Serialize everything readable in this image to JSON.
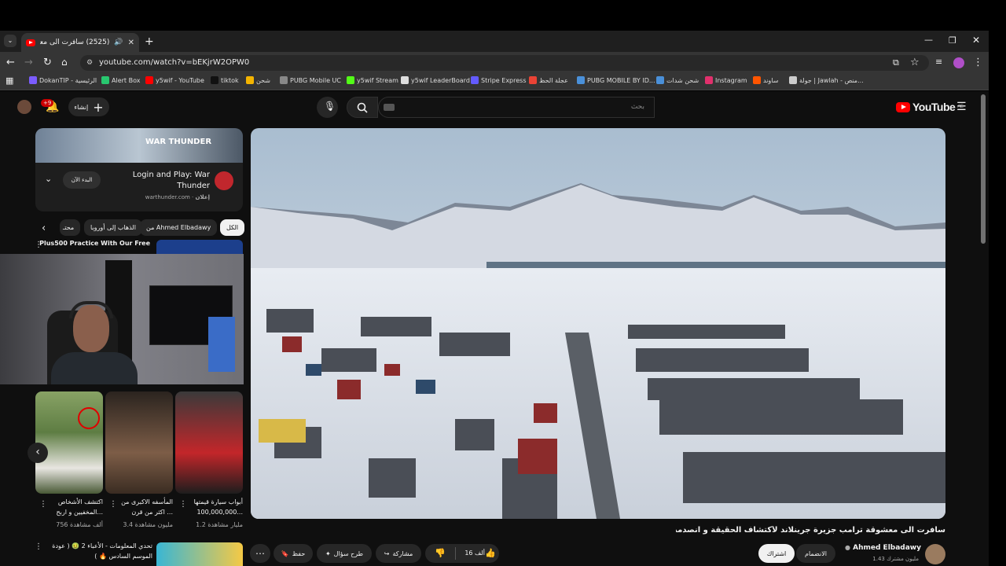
{
  "browser": {
    "tab_title": "(2525) سافرت الى معشوقة :",
    "url": "youtube.com/watch?v=bEKjrW2OPW0",
    "bookmarks": [
      {
        "label": "DokanTIP - الرئيسية",
        "color": "#7b5cff"
      },
      {
        "label": "Alert Box",
        "color": "#28c76f"
      },
      {
        "label": "y5wif - YouTube",
        "color": "#ff0000"
      },
      {
        "label": "tiktok",
        "color": "#111111"
      },
      {
        "label": "شحن",
        "color": "#f4b400"
      },
      {
        "label": "PUBG Mobile UC",
        "color": "#888888"
      },
      {
        "label": "y5wif Stream",
        "color": "#53fc18"
      },
      {
        "label": "y5wif LeaderBoard",
        "color": "#dddddd"
      },
      {
        "label": "Stripe Express",
        "color": "#635bff"
      },
      {
        "label": "عجلة الحظ",
        "color": "#ea4335"
      },
      {
        "label": "PUBG MOBILE BY ID...",
        "color": "#4a90d9"
      },
      {
        "label": "شحن شدات",
        "color": "#4a90d9"
      },
      {
        "label": "Instagram",
        "color": "#e1306c"
      },
      {
        "label": "ساوند",
        "color": "#ff5500"
      },
      {
        "label": "جولة | Jawlah - منص...",
        "color": "#cccccc"
      }
    ]
  },
  "youtube": {
    "search_placeholder": "بحث",
    "create_label": "إنشاء",
    "notifications_badge": "+9",
    "logo_text": "YouTube",
    "logo_country": "AE"
  },
  "ad": {
    "title": "Login and Play: War Thunder",
    "sponsor_label": "إعلان",
    "domain": "warthunder.com",
    "cta": "البدء الآن"
  },
  "chips": [
    "الكل",
    "من Ahmed Elbadawy",
    "الذهاب إلى أوروبا",
    "محتـ"
  ],
  "plus500": {
    "title": "Plus500 Practice With Our Free"
  },
  "shorts": [
    {
      "title": "اكتشف الأشخاص المخفيين و اربح...",
      "views": "756 ألف مشاهدة"
    },
    {
      "title": "المأسفه الاكبرى من اكثر من قرن ...",
      "views": "3.4 مليون مشاهدة"
    },
    {
      "title": "أبواب سيارة قيمتها 100,000,000...",
      "views": "1.2 مليار مشاهدة"
    }
  ],
  "next_video": {
    "title": "تحدي المعلومات - الأعباء 2 🤢 ( عودة الموسم السادس 🔥 )"
  },
  "video": {
    "title": "سافرت الى معشوقة ترامب جزيرة جرينلاند لأكتشاف الحقيقة و انصدمت😱",
    "channel": "Ahmed Elbadawy",
    "subscribers": "1.43 مليون مشترك",
    "join_label": "الانضمام",
    "subscribe_label": "اشتراك",
    "likes": "16 ألف",
    "share_label": "مشاركة",
    "ask_label": "طرح سؤال",
    "save_label": "حفظ"
  }
}
